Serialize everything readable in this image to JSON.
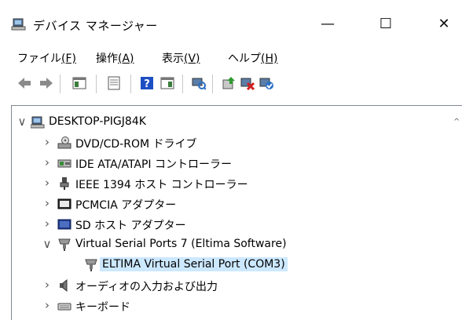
{
  "window": {
    "title": "デバイス マネージャー",
    "min_glyph": "—",
    "max_glyph": "☐",
    "close_glyph": "✕"
  },
  "menu": [
    {
      "label": "ファイル",
      "accel": "(F)"
    },
    {
      "label": "操作",
      "accel": "(A)"
    },
    {
      "label": "表示",
      "accel": "(V)"
    },
    {
      "label": "ヘルプ",
      "accel": "(H)"
    }
  ],
  "tree": {
    "root": {
      "label": "DESKTOP-PIGJ84K",
      "expander": "∨"
    },
    "items": [
      {
        "label": "DVD/CD-ROM ドライブ",
        "expander": "›"
      },
      {
        "label": "IDE ATA/ATAPI コントローラー",
        "expander": "›"
      },
      {
        "label": "IEEE 1394 ホスト コントローラー",
        "expander": "›"
      },
      {
        "label": "PCMCIA アダプター",
        "expander": "›"
      },
      {
        "label": "SD ホスト アダプター",
        "expander": "›"
      },
      {
        "label": "Virtual Serial Ports 7 (Eltima Software)",
        "expander": "∨"
      },
      {
        "label": "ELTIMA Virtual Serial Port (COM3)",
        "expander": ""
      },
      {
        "label": "オーディオの入力および出力",
        "expander": "›"
      },
      {
        "label": "キーボード",
        "expander": "›"
      }
    ]
  },
  "scrollbar": {
    "up_glyph": "^"
  }
}
